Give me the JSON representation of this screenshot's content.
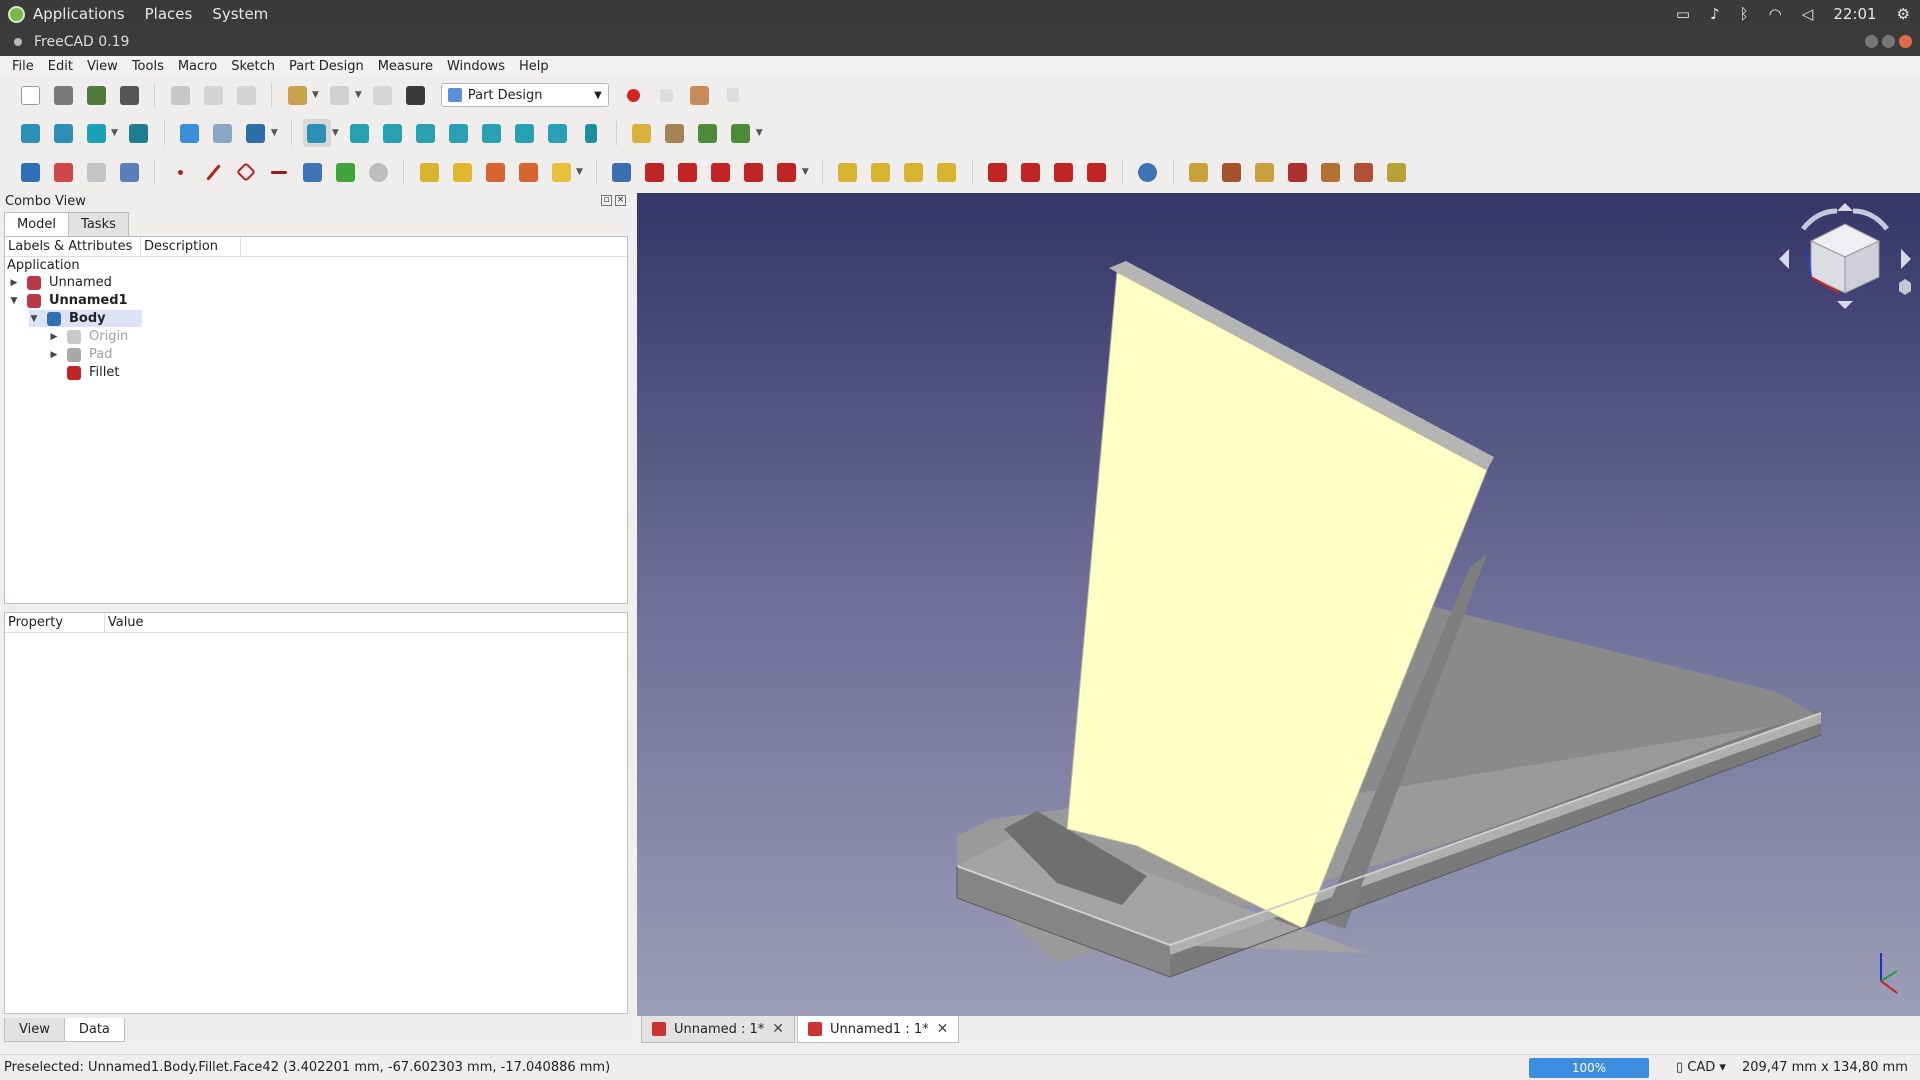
{
  "system_bar": {
    "menus": [
      "Applications",
      "Places",
      "System"
    ],
    "clock": "22:01",
    "tray_icons": [
      "monitor-icon",
      "bell-icon",
      "bluetooth-icon",
      "wifi-icon",
      "volume-icon",
      "gear-icon"
    ]
  },
  "window": {
    "title": "FreeCAD 0.19"
  },
  "menubar": [
    "File",
    "Edit",
    "View",
    "Tools",
    "Macro",
    "Sketch",
    "Part Design",
    "Measure",
    "Windows",
    "Help"
  ],
  "toolbar": {
    "workbench": "Part Design"
  },
  "combo_view": {
    "title": "Combo View",
    "tabs": [
      "Model",
      "Tasks"
    ],
    "tree_columns": [
      "Labels & Attributes",
      "Description"
    ],
    "tree": {
      "root": "Application",
      "items": [
        {
          "label": "Unnamed"
        },
        {
          "label": "Unnamed1"
        },
        {
          "label": "Body"
        },
        {
          "label": "Origin"
        },
        {
          "label": "Pad"
        },
        {
          "label": "Fillet"
        }
      ]
    },
    "property_columns": [
      "Property",
      "Value"
    ],
    "bottom_tabs": [
      "View",
      "Data"
    ]
  },
  "doc_tabs": [
    {
      "label": "Unnamed : 1*"
    },
    {
      "label": "Unnamed1 : 1*"
    }
  ],
  "status_bar": {
    "message": "Preselected: Unnamed1.Body.Fillet.Face42 (3.402201 mm, -67.602303 mm, -17.040886 mm)",
    "progress": "100%",
    "nav_style": "CAD",
    "dimensions": "209,47 mm x 134,80 mm"
  },
  "colors": {
    "face_highlight": "#ffffc6",
    "model_gray": "#8e8e8e",
    "background_top": "#353567",
    "background_bottom": "#9d9db7",
    "selection": "#dde3f7",
    "progress": "#3d8ee0"
  }
}
